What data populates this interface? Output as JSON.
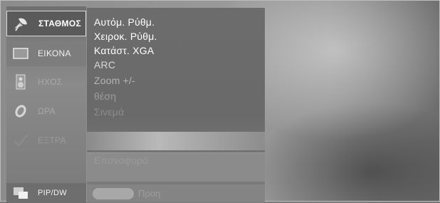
{
  "sidebar": {
    "items": [
      {
        "key": "station",
        "label": "ΣΤΑΘΜΟΣ",
        "icon": "satellite-dish-icon"
      },
      {
        "key": "picture",
        "label": "ΕΙΚΟΝΑ",
        "icon": "screen-icon"
      },
      {
        "key": "sound",
        "label": "ΗΧΟΣ",
        "icon": "speaker-icon"
      },
      {
        "key": "time",
        "label": "ΩΡΑ",
        "icon": "clock-icon"
      },
      {
        "key": "extra",
        "label": "ΕΞΤΡΑ",
        "icon": "check-icon"
      },
      {
        "key": "pip",
        "label": "PIP/DW",
        "icon": "pip-icon"
      }
    ]
  },
  "submenu": {
    "options": [
      "Αυτόμ. Ρύθμ.",
      "Χειροκ. Ρύθμ.",
      "Κατάστ. XGA",
      "ARC",
      "Zoom +/-",
      "θέση",
      "Σινεμά"
    ],
    "reset_label": "Επαναφορά",
    "bottom_label": "Προη"
  },
  "colors": {
    "background": "#8c8c8c",
    "sidebar": "#7a7a7a",
    "selected_item": "#5a5a5a",
    "text_active": "#ffffff",
    "text_faded": "#9c9c9c"
  }
}
